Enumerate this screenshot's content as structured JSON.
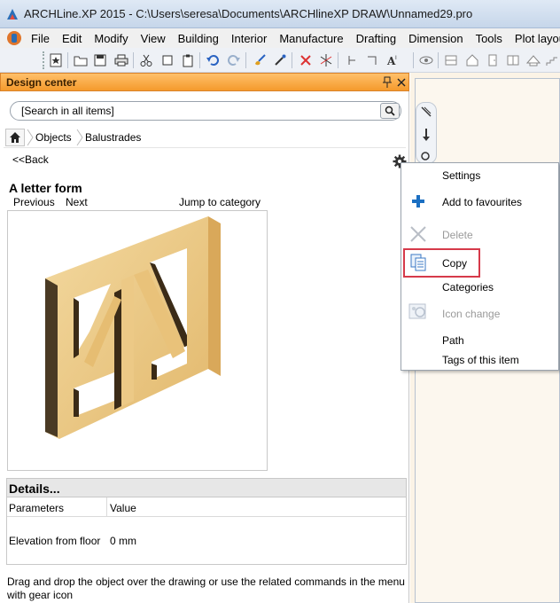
{
  "window": {
    "title": "ARCHLine.XP 2015 - C:\\Users\\seresa\\Documents\\ARCHlineXP DRAW\\Unnamed29.pro"
  },
  "menu": [
    "File",
    "Edit",
    "Modify",
    "View",
    "Building",
    "Interior",
    "Manufacture",
    "Drafting",
    "Dimension",
    "Tools",
    "Plot layout"
  ],
  "design_center": {
    "title": "Design center",
    "search_placeholder": "[Search in all items]",
    "breadcrumb": [
      "Objects",
      "Balustrades"
    ],
    "back_label": "<<Back",
    "item_title": "A letter form",
    "nav": {
      "previous": "Previous",
      "next": "Next",
      "jump": "Jump to category"
    },
    "details_title": "Details...",
    "table": {
      "headers": [
        "Parameters",
        "Value"
      ],
      "rows": [
        {
          "param": "Elevation from floor",
          "value": "0 mm"
        }
      ]
    },
    "help_text": "Drag and drop the object over the drawing or use the related commands in the menu with gear icon"
  },
  "context_menu": {
    "items": [
      {
        "label": "Settings",
        "icon": "none",
        "enabled": true
      },
      {
        "label": "Add to favourites",
        "icon": "plus-icon",
        "enabled": true
      },
      {
        "label": "Delete",
        "icon": "x-icon",
        "enabled": false
      },
      {
        "label": "Copy",
        "icon": "copy-icon",
        "enabled": true,
        "highlighted": true
      },
      {
        "label": "Categories",
        "icon": "none",
        "enabled": true
      },
      {
        "label": "Icon change",
        "icon": "image-icon",
        "enabled": false
      },
      {
        "label": "Path",
        "icon": "none",
        "enabled": true
      },
      {
        "label": "Tags of this item",
        "icon": "none",
        "enabled": true
      }
    ]
  },
  "colors": {
    "panel_header": "#f59a2c",
    "highlight_border": "#d63a4a",
    "drawing_background": "#fcf7ee"
  }
}
